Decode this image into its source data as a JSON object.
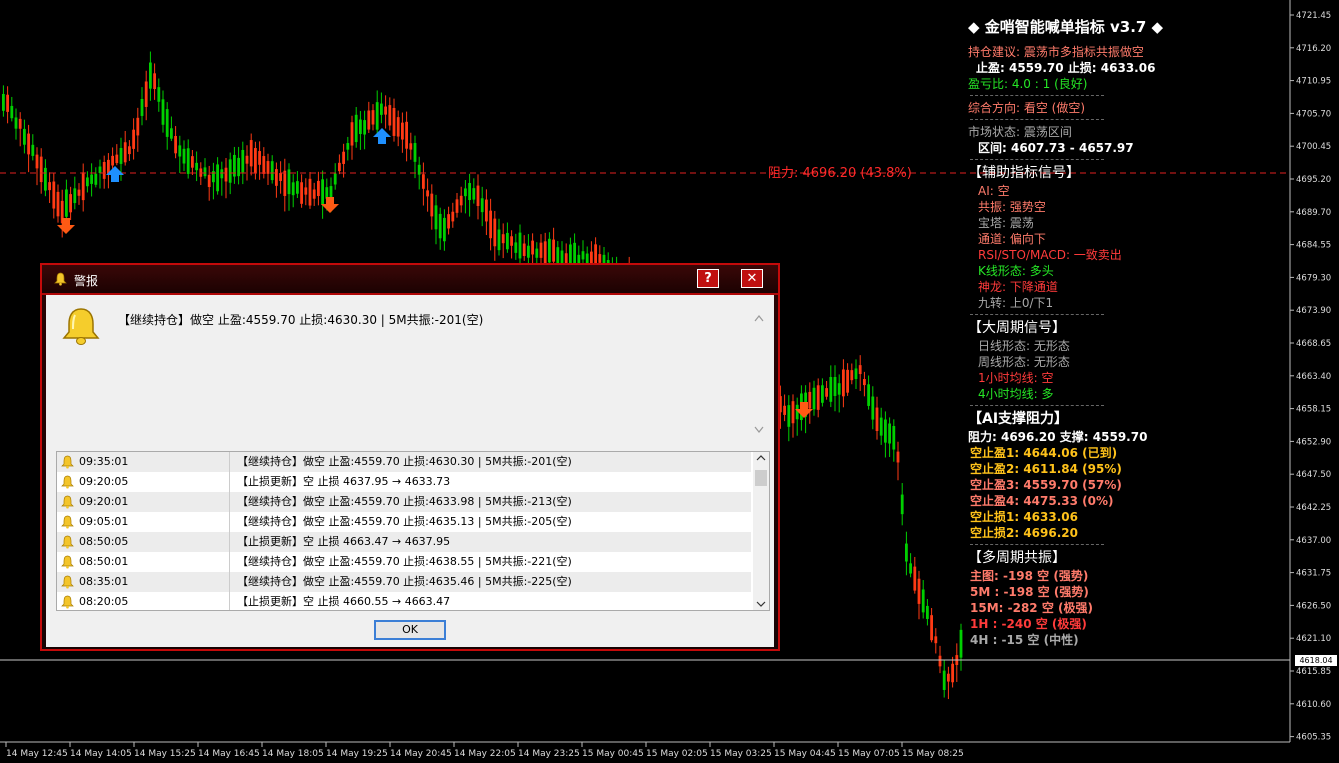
{
  "chart": {
    "resistance_label": "阻力: 4696.20 (43.8%)",
    "price_axis": [
      "4721.45",
      "4716.20",
      "4710.95",
      "4705.70",
      "4700.45",
      "4695.20",
      "4689.70",
      "4684.55",
      "4679.30",
      "4673.90",
      "4668.65",
      "4663.40",
      "4658.15",
      "4652.90",
      "4647.50",
      "4642.25",
      "4637.00",
      "4631.75",
      "4626.50",
      "4621.10",
      "4615.85",
      "4610.60",
      "4605.35"
    ],
    "current_price": "4618.04",
    "time_axis": [
      "14 May 12:45",
      "14 May 14:05",
      "14 May 15:25",
      "14 May 16:45",
      "14 May 18:05",
      "14 May 19:25",
      "14 May 20:45",
      "14 May 22:05",
      "14 May 23:25",
      "15 May 00:45",
      "15 May 02:05",
      "15 May 03:25",
      "15 May 04:45",
      "15 May 07:05",
      "15 May 08:25"
    ],
    "colors": {
      "up": "#00d000",
      "down": "#ff3a14",
      "resistance": "#e02020",
      "arrow_up": "#1e90ff",
      "arrow_down": "#ff5a14"
    }
  },
  "panel": {
    "title": "◆ 金哨智能喊单指标 v3.7 ◆",
    "position_advice": "持仓建议: 震荡市多指标共振做空",
    "tp_sl": "止盈: 4559.70  止损: 4633.06",
    "rr": "盈亏比: 4.0 : 1 (良好)",
    "direction": "综合方向: 看空 (做空)",
    "market_state": "市场状态: 震荡区间",
    "range": "区间: 4607.73 - 4657.97",
    "aux_header": "【辅助指标信号】",
    "aux": [
      {
        "text": "AI: 空",
        "color": "sal"
      },
      {
        "text": "共振: 强势空",
        "color": "sal"
      },
      {
        "text": "宝塔: 震荡",
        "color": "gray"
      },
      {
        "text": "通道: 偏向下",
        "color": "sal"
      },
      {
        "text": "RSI/STO/MACD: 一致卖出",
        "color": "red"
      },
      {
        "text": "K线形态: 多头",
        "color": "green"
      },
      {
        "text": "神龙: 下降通道",
        "color": "red"
      },
      {
        "text": "九转: 上0/下1",
        "color": "gray"
      }
    ],
    "big_header": "【大周期信号】",
    "big": [
      {
        "text": "日线形态: 无形态",
        "color": "gray"
      },
      {
        "text": "周线形态: 无形态",
        "color": "gray"
      },
      {
        "text": "1小时均线: 空",
        "color": "red"
      },
      {
        "text": "4小时均线: 多",
        "color": "green"
      }
    ],
    "ai_header": "【AI支撑阻力】",
    "sr": "阻力: 4696.20   支撑: 4559.70",
    "levels": [
      {
        "text": "空止盈1: 4644.06 (已到)",
        "color": "gold"
      },
      {
        "text": "空止盈2: 4611.84 (95%)",
        "color": "gold"
      },
      {
        "text": "空止盈3: 4559.70 (57%)",
        "color": "sal"
      },
      {
        "text": "空止盈4: 4475.33 (0%)",
        "color": "sal"
      },
      {
        "text": "空止损1: 4633.06",
        "color": "gold"
      },
      {
        "text": "空止损2: 4696.20",
        "color": "gold"
      }
    ],
    "multi_header": "【多周期共振】",
    "multi": [
      {
        "text": "主图: -198 空 (强势)",
        "color": "sal"
      },
      {
        "text": "5M : -198 空 (强势)",
        "color": "sal"
      },
      {
        "text": "15M: -282 空 (极强)",
        "color": "sal"
      },
      {
        "text": "1H : -240 空 (极强)",
        "color": "red"
      },
      {
        "text": "4H : -15 空 (中性)",
        "color": "gray"
      }
    ]
  },
  "dialog": {
    "title": "警报",
    "help_btn": "?",
    "close_btn": "✕",
    "message": "【继续持仓】做空 止盈:4559.70 止损:4630.30 | 5M共振:-201(空)",
    "rows": [
      {
        "time": "09:35:01",
        "msg": "【继续持仓】做空 止盈:4559.70 止损:4630.30 | 5M共振:-201(空)"
      },
      {
        "time": "09:20:05",
        "msg": "【止损更新】空 止损 4637.95 → 4633.73"
      },
      {
        "time": "09:20:01",
        "msg": "【继续持仓】做空 止盈:4559.70 止损:4633.98 | 5M共振:-213(空)"
      },
      {
        "time": "09:05:01",
        "msg": "【继续持仓】做空 止盈:4559.70 止损:4635.13 | 5M共振:-205(空)"
      },
      {
        "time": "08:50:05",
        "msg": "【止损更新】空 止损 4663.47 → 4637.95"
      },
      {
        "time": "08:50:01",
        "msg": "【继续持仓】做空 止盈:4559.70 止损:4638.55 | 5M共振:-221(空)"
      },
      {
        "time": "08:35:01",
        "msg": "【继续持仓】做空 止盈:4559.70 止损:4635.46 | 5M共振:-225(空)"
      },
      {
        "time": "08:20:05",
        "msg": "【止损更新】空 止损 4660.55 → 4663.47"
      }
    ],
    "ok": "OK"
  }
}
